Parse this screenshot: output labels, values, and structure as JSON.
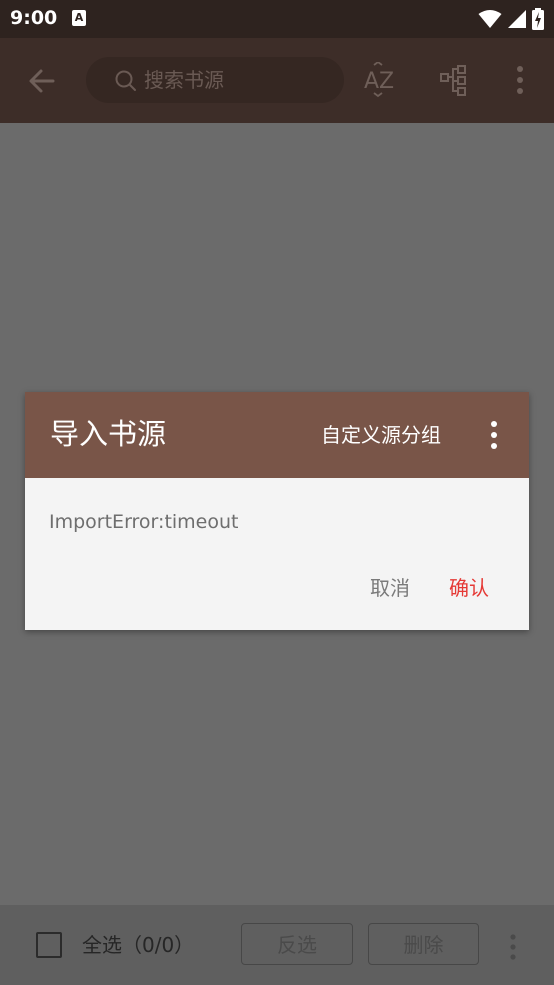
{
  "status_bar": {
    "time": "9:00",
    "notification_icon": "a11y-a-icon",
    "icons": [
      "wifi-icon",
      "signal-icon",
      "battery-charging-icon"
    ]
  },
  "toolbar": {
    "back_icon": "arrow-back-icon",
    "search_placeholder": "搜索书源",
    "sort_icon": "sort-az-icon",
    "group_icon": "group-tree-icon",
    "more_icon": "more-vert-icon"
  },
  "dialog": {
    "title": "导入书源",
    "action_label": "自定义源分组",
    "message": "ImportError:timeout",
    "cancel_label": "取消",
    "confirm_label": "确认"
  },
  "bottom_bar": {
    "select_all_label": "全选（0/0）",
    "invert_label": "反选",
    "delete_label": "删除"
  },
  "colors": {
    "status_bar": "#2e231f",
    "toolbar": "#3d2d28",
    "dialog_header": "#795548",
    "dialog_body": "#f4f4f4",
    "confirm": "#e53935",
    "scrim": "#6b6b6b"
  }
}
